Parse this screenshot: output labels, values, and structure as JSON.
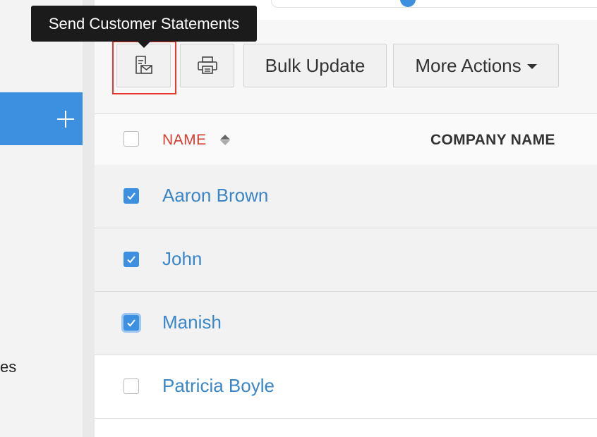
{
  "sidebar": {
    "partial_label": "es"
  },
  "tooltip": {
    "text": "Send Customer Statements"
  },
  "toolbar": {
    "send_statements_icon": "statement-mail-icon",
    "print_icon": "printer-icon",
    "bulk_update_label": "Bulk Update",
    "more_actions_label": "More Actions"
  },
  "table": {
    "columns": {
      "name": "NAME",
      "company": "COMPANY NAME"
    },
    "rows": [
      {
        "name": "Aaron Brown",
        "checked": true
      },
      {
        "name": "John",
        "checked": true
      },
      {
        "name": "Manish",
        "checked": true
      },
      {
        "name": "Patricia Boyle",
        "checked": false
      }
    ]
  },
  "colors": {
    "accent": "#3d8fe0",
    "sort_active": "#d63d2f",
    "link": "#3a86c8",
    "highlight": "#e8382d"
  }
}
